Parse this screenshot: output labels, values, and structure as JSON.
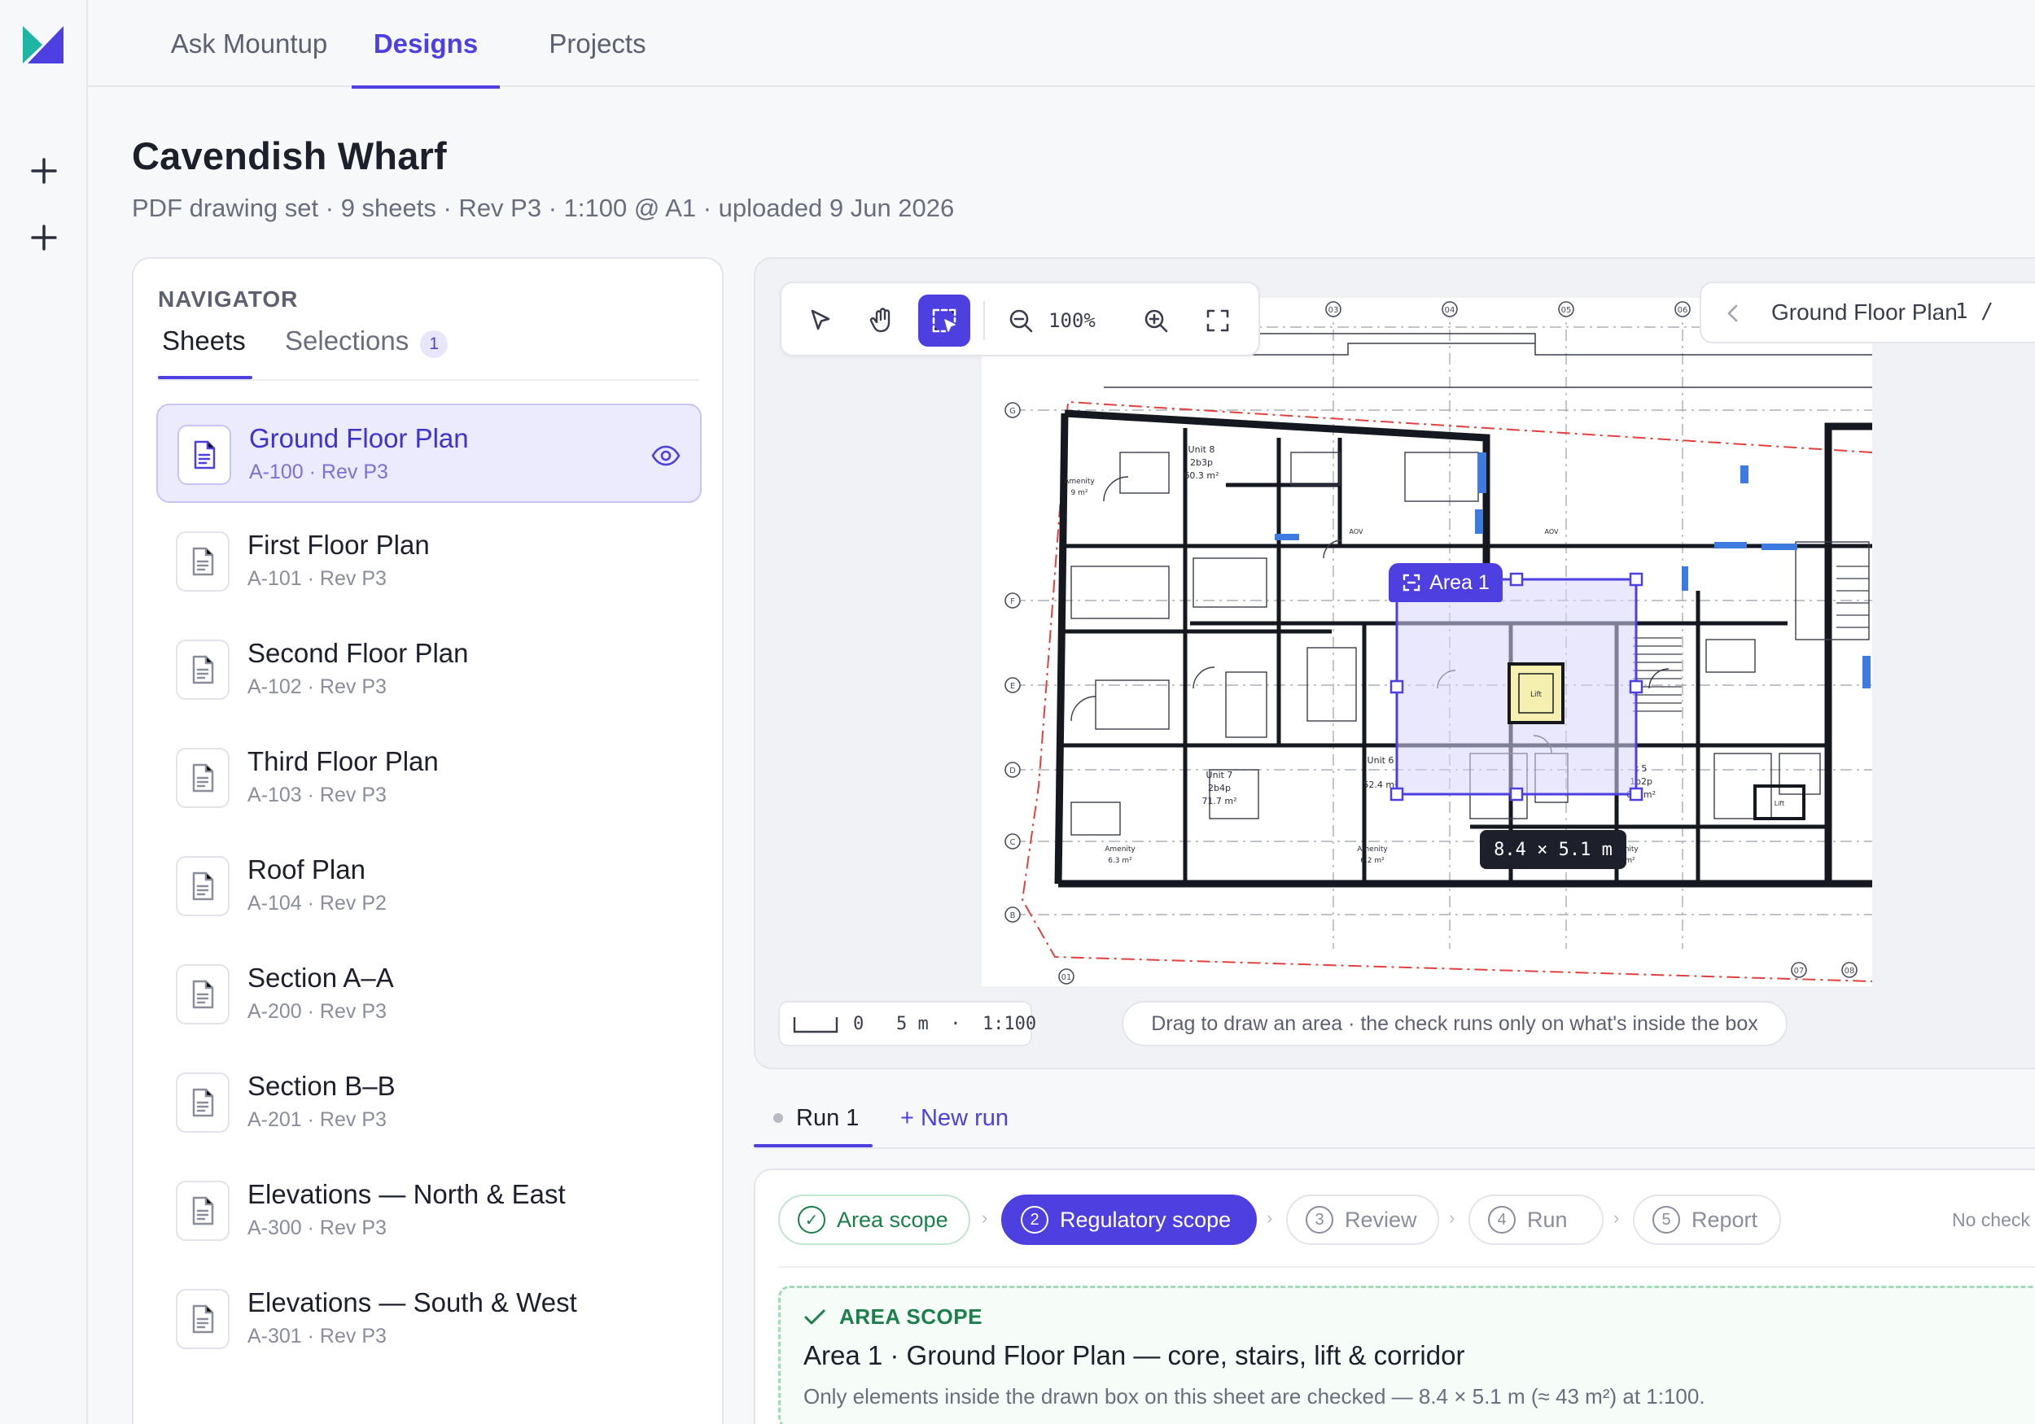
{
  "nav": {
    "tabs": [
      {
        "label": "Ask Mountup"
      },
      {
        "label": "Designs"
      },
      {
        "label": "Projects"
      }
    ]
  },
  "project": {
    "title": "Cavendish Wharf",
    "subtitle": "PDF drawing set · 9 sheets · Rev P3 · 1:100 @ A1 · uploaded 9 Jun 2026"
  },
  "navigator": {
    "heading": "NAVIGATOR",
    "tab_sheets": "Sheets",
    "tab_selections": "Selections",
    "selections_count": "1",
    "sheets": [
      {
        "name": "Ground Floor Plan",
        "meta": "A-100 · Rev P3"
      },
      {
        "name": "First Floor Plan",
        "meta": "A-101 · Rev P3"
      },
      {
        "name": "Second Floor Plan",
        "meta": "A-102 · Rev P3"
      },
      {
        "name": "Third Floor Plan",
        "meta": "A-103 · Rev P3"
      },
      {
        "name": "Roof Plan",
        "meta": "A-104 · Rev P2"
      },
      {
        "name": "Section A–A",
        "meta": "A-200 · Rev P3"
      },
      {
        "name": "Section B–B",
        "meta": "A-201 · Rev P3"
      },
      {
        "name": "Elevations — North & East",
        "meta": "A-300 · Rev P3"
      },
      {
        "name": "Elevations — South & West",
        "meta": "A-301 · Rev P3"
      }
    ]
  },
  "viewer": {
    "zoom": "100%",
    "sheet_name": "Ground Floor Plan",
    "sheet_sep": "·",
    "sheet_page": "1 /",
    "scale_bar": "0   5 m  ·  1:100",
    "hint": "Drag to draw an area · the check runs only on what's inside the box",
    "area_label": "Area 1",
    "area_dims": "8.4 × 5.1 m",
    "grid_top": [
      "03",
      "04",
      "05",
      "06"
    ],
    "grid_left": [
      "G",
      "F",
      "E",
      "D",
      "C",
      "B"
    ],
    "grid_bottom": [
      "01",
      "07",
      "08"
    ],
    "room_labels": {
      "unit8": "Unit 8",
      "unit8_type": "2b3p",
      "unit8_area": "60.3 m²",
      "unit7": "Unit 7",
      "unit7_type": "2b4p",
      "unit7_area": "71.7 m²",
      "unit6": "Unit 6",
      "unit6_area": "52.4 m²",
      "unit5": "t 5",
      "unit5_type": "1b2p",
      "unit5_area": "0.5 m²",
      "amenity": "Amenity",
      "amenity_area_1": "9 m²",
      "amenity_area_2": "6.3 m²",
      "amenity_area_3": "6.2 m²",
      "amenity_area_4": "5.8 m²",
      "lift": "Lift",
      "lift_right": "Lift",
      "aov": "AOV",
      "aov_1": "AOV"
    },
    "colors": {
      "accent": "#4d3fe0",
      "boundary": "#e0413f",
      "selection_fill": "#d9d6fb"
    }
  },
  "runs": {
    "tabs": [
      {
        "label": "Run 1"
      },
      {
        "label": "+ New run"
      }
    ]
  },
  "steps": [
    {
      "num": "✓",
      "label": "Area scope",
      "state": "done"
    },
    {
      "num": "2",
      "label": "Regulatory scope",
      "state": "current"
    },
    {
      "num": "3",
      "label": "Review",
      "state": "pending"
    },
    {
      "num": "4",
      "label": "Run",
      "state": "pending"
    },
    {
      "num": "5",
      "label": "Report",
      "state": "pending"
    }
  ],
  "steps_status": "No check",
  "scope": {
    "label": "AREA SCOPE",
    "title": "Area 1 · Ground Floor Plan — core, stairs, lift & corridor",
    "desc": "Only elements inside the drawn box on this sheet are checked — 8.4 × 5.1 m (≈ 43 m²) at 1:100."
  }
}
